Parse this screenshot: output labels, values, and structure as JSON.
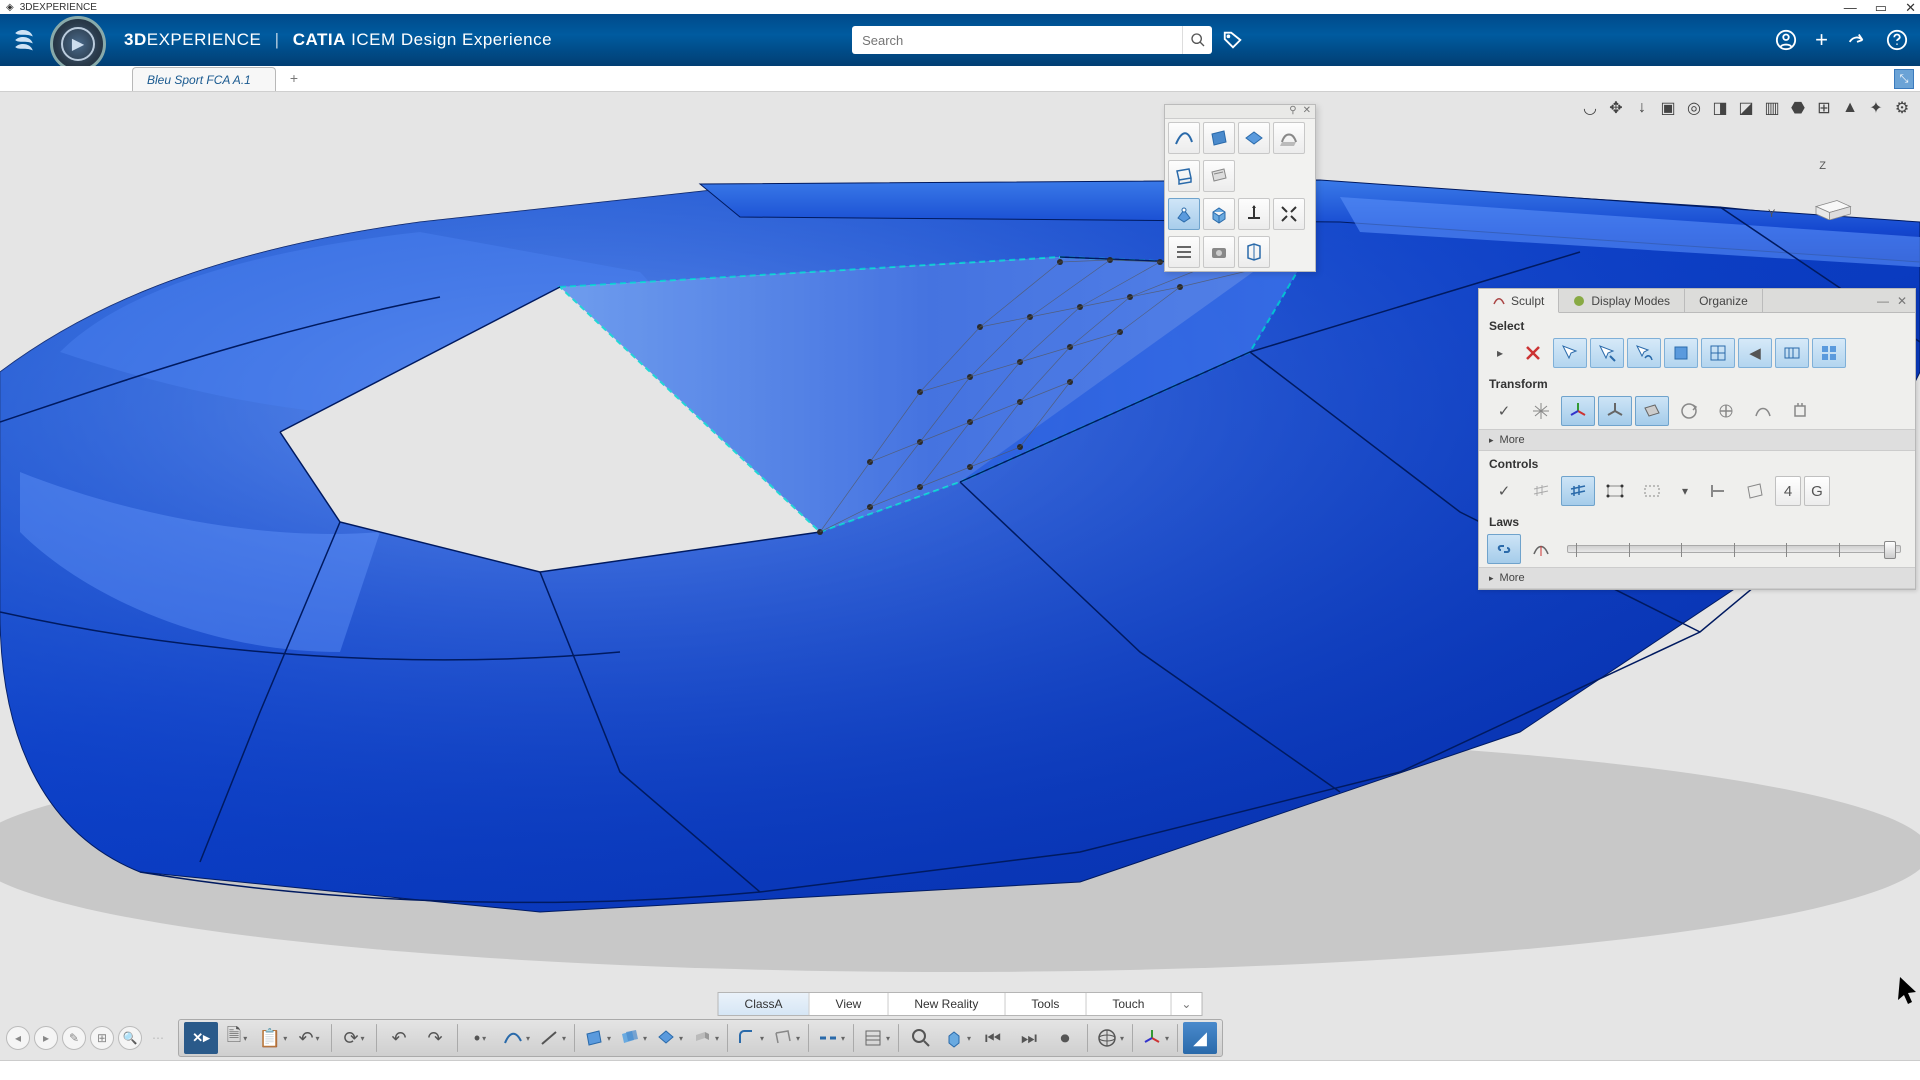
{
  "titlebar": {
    "app_name": "3DEXPERIENCE"
  },
  "header": {
    "brand_bold": "3D",
    "brand_rest": "EXPERIENCE",
    "divider": "|",
    "app_bold": "CATIA",
    "app_rest": "ICEM Design Experience",
    "search_placeholder": "Search"
  },
  "tabs": {
    "doc_name": "Bleu Sport FCA A.1"
  },
  "triad": {
    "z": "Z",
    "y": "Y"
  },
  "panel": {
    "tab_sculpt": "Sculpt",
    "tab_display": "Display Modes",
    "tab_organize": "Organize",
    "section_select": "Select",
    "section_transform": "Transform",
    "more": "More",
    "section_controls": "Controls",
    "controls_num": "4",
    "controls_g": "G",
    "section_laws": "Laws"
  },
  "action_tabs": {
    "class_a": "ClassA",
    "view": "View",
    "new_reality": "New Reality",
    "tools": "Tools",
    "touch": "Touch"
  }
}
